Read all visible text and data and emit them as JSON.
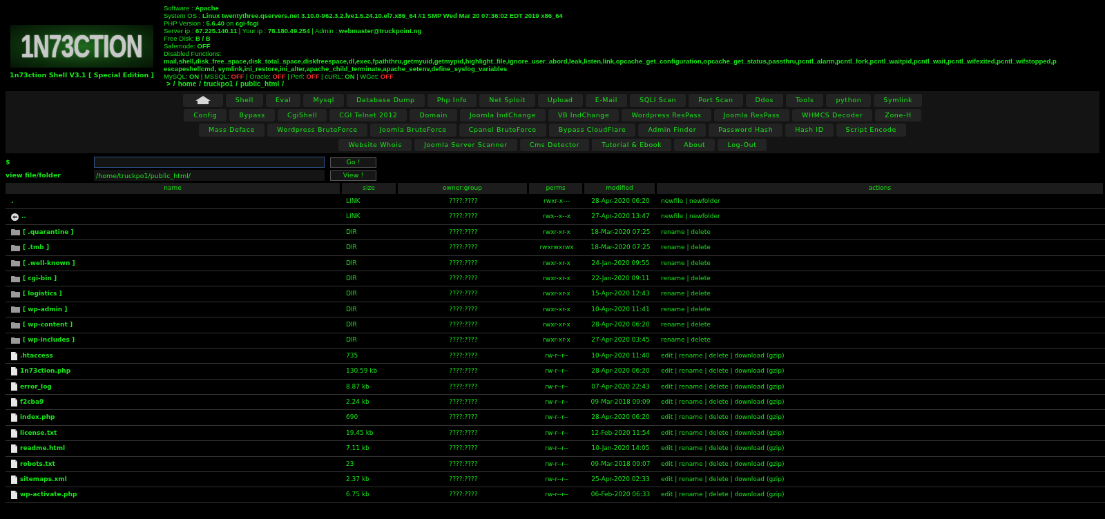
{
  "logo": {
    "text": "1N73CTION",
    "caption": "1n73ction Shell V3.1 [ Special Edition ]"
  },
  "info_lines": [
    "Software : **Apache**",
    "System OS : **Linux twentythree.qservers.net 3.10.0-962.3.2.lve1.5.24.10.el7.x86_64 #1 SMP Wed Mar 20 07:36:02 EDT 2019 x86_64**",
    "PHP Version : **5.6.40** on **cgi-fcgi**",
    "Server ip : **67.225.140.11** | Your ip : **78.180.49.254** | Admin : **webmaster@truckpoint.ng**",
    "Free Disk: **B / B**",
    "Safemode: **OFF**",
    "Disabled Functions:",
    "**mail,shell,disk_free_space,disk_total_space,diskfreespace,dl,exec,fpaththru,getmyuid,getmypid,highlight_file,ignore_user_abord,leak,listen,link,opcache_get_configuration,opcache_get_status,passthru,pcntl_alarm,pcntl_fork,pcntl_waitpid,pcntl_wait,pcntl_wifexited,pcntl_wifstopped,p**",
    "**escapeshellcmd, symlink,ini_restore,ini_alter,apache_child_terminate,apache_setenv,define_syslog_variables**"
  ],
  "separator": "|",
  "services": [
    {
      "label": "MySQL:",
      "value": "ON",
      "on": true
    },
    {
      "label": "MSSQL:",
      "value": "OFF",
      "on": false
    },
    {
      "label": "Oracle:",
      "value": "OFF",
      "on": false
    },
    {
      "label": "Perl:",
      "value": "OFF",
      "on": false
    },
    {
      "label": "cURL:",
      "value": "ON",
      "on": true
    },
    {
      "label": "WGet:",
      "value": "OFF",
      "on": false
    }
  ],
  "path": {
    "prefix": ">",
    "root": "/",
    "segments": [
      "home",
      "truckpo1",
      "public_html"
    ]
  },
  "menu_rows": [
    {
      "home": true,
      "items": [
        "Shell",
        "Eval",
        "Mysql",
        "Database Dump",
        "Php Info",
        "Net Sploit",
        "Upload",
        "E-Mail",
        "SQLI Scan",
        "Port Scan",
        "Ddos",
        "Tools",
        "python",
        "Symlink"
      ]
    },
    {
      "home": false,
      "items": [
        "Config",
        "Bypass",
        "CgiShell",
        "CGI Telnet 2012",
        "Domain",
        "Joomla IndChange",
        "VB IndChange",
        "Wordpress ResPass",
        "Joomla ResPass",
        "WHMCS Decoder",
        "Zone-H"
      ]
    },
    {
      "home": false,
      "items": [
        "Mass Deface",
        "Wordpress BruteForce",
        "Joomla BruteForce",
        "Cpanel BruteForce",
        "Bypass CloudFlare",
        "Admin Finder",
        "Password Hash",
        "Hash ID",
        "Script Encode"
      ]
    },
    {
      "home": false,
      "items": [
        "Website Whois",
        "Joomla Server Scanner",
        "Cms Detector",
        "Tutorial & Ebook",
        "About",
        "Log-Out"
      ]
    }
  ],
  "command": {
    "label": "$",
    "button": "Go !"
  },
  "view": {
    "label": "view file/folder",
    "value": "/home/truckpo1/public_html/",
    "button": "View !"
  },
  "table": {
    "columns": [
      "name",
      "size",
      "owner:group",
      "perms",
      "modified",
      "actions"
    ],
    "rows": [
      {
        "kind": "link",
        "name": ".",
        "size": "LINK",
        "owner": "????:????",
        "perms": "rwxr-x---",
        "modified": "28-Apr-2020 06:20",
        "actions": [
          "newfile",
          "newfolder"
        ]
      },
      {
        "kind": "parent",
        "name": "..",
        "size": "LINK",
        "owner": "????:????",
        "perms": "rwx--x--x",
        "modified": "27-Apr-2020 13:47",
        "actions": [
          "newfile",
          "newfolder"
        ]
      },
      {
        "kind": "dir",
        "name": "[ .quarantine ]",
        "size": "DIR",
        "owner": "????:????",
        "perms": "rwxr-xr-x",
        "modified": "18-Mar-2020 07:25",
        "actions": [
          "rename",
          "delete"
        ]
      },
      {
        "kind": "dir",
        "name": "[ .tmb ]",
        "size": "DIR",
        "owner": "????:????",
        "perms": "rwxrwxrwx",
        "modified": "18-Mar-2020 07:25",
        "actions": [
          "rename",
          "delete"
        ]
      },
      {
        "kind": "dir",
        "name": "[ .well-known ]",
        "size": "DIR",
        "owner": "????:????",
        "perms": "rwxr-xr-x",
        "modified": "24-Jan-2020 09:55",
        "actions": [
          "rename",
          "delete"
        ]
      },
      {
        "kind": "dir",
        "name": "[ cgi-bin ]",
        "size": "DIR",
        "owner": "????:????",
        "perms": "rwxr-xr-x",
        "modified": "22-Jan-2020 09:11",
        "actions": [
          "rename",
          "delete"
        ]
      },
      {
        "kind": "dir",
        "name": "[ logistics ]",
        "size": "DIR",
        "owner": "????:????",
        "perms": "rwxr-xr-x",
        "modified": "15-Apr-2020 12:43",
        "actions": [
          "rename",
          "delete"
        ]
      },
      {
        "kind": "dir",
        "name": "[ wp-admin ]",
        "size": "DIR",
        "owner": "????:????",
        "perms": "rwxr-xr-x",
        "modified": "10-Apr-2020 11:41",
        "actions": [
          "rename",
          "delete"
        ]
      },
      {
        "kind": "dir",
        "name": "[ wp-content ]",
        "size": "DIR",
        "owner": "????:????",
        "perms": "rwxr-xr-x",
        "modified": "28-Apr-2020 06:20",
        "actions": [
          "rename",
          "delete"
        ]
      },
      {
        "kind": "dir",
        "name": "[ wp-includes ]",
        "size": "DIR",
        "owner": "????:????",
        "perms": "rwxr-xr-x",
        "modified": "27-Apr-2020 03:45",
        "actions": [
          "rename",
          "delete"
        ]
      },
      {
        "kind": "file",
        "name": ".htaccess",
        "size": "735",
        "owner": "????:????",
        "perms": "rw-r--r--",
        "modified": "10-Apr-2020 11:40",
        "actions": [
          "edit",
          "rename",
          "delete",
          "download (gzip)"
        ]
      },
      {
        "kind": "file",
        "name": "1n73ction.php",
        "size": "130.59 kb",
        "owner": "????:????",
        "perms": "rw-r--r--",
        "modified": "28-Apr-2020 06:20",
        "actions": [
          "edit",
          "rename",
          "delete",
          "download (gzip)"
        ]
      },
      {
        "kind": "file",
        "name": "error_log",
        "size": "8.87 kb",
        "owner": "????:????",
        "perms": "rw-r--r--",
        "modified": "07-Apr-2020 22:43",
        "actions": [
          "edit",
          "rename",
          "delete",
          "download (gzip)"
        ]
      },
      {
        "kind": "file",
        "name": "f2cba9",
        "size": "2.24 kb",
        "owner": "????:????",
        "perms": "rw-r--r--",
        "modified": "09-Mar-2018 09:09",
        "actions": [
          "edit",
          "rename",
          "delete",
          "download (gzip)"
        ]
      },
      {
        "kind": "file",
        "name": "index.php",
        "size": "690",
        "owner": "????:????",
        "perms": "rw-r--r--",
        "modified": "28-Apr-2020 06:20",
        "actions": [
          "edit",
          "rename",
          "delete",
          "download (gzip)"
        ]
      },
      {
        "kind": "file",
        "name": "license.txt",
        "size": "19.45 kb",
        "owner": "????:????",
        "perms": "rw-r--r--",
        "modified": "12-Feb-2020 11:54",
        "actions": [
          "edit",
          "rename",
          "delete",
          "download (gzip)"
        ]
      },
      {
        "kind": "file",
        "name": "readme.html",
        "size": "7.11 kb",
        "owner": "????:????",
        "perms": "rw-r--r--",
        "modified": "10-Jan-2020 14:05",
        "actions": [
          "edit",
          "rename",
          "delete",
          "download (gzip)"
        ]
      },
      {
        "kind": "file",
        "name": "robots.txt",
        "size": "23",
        "owner": "????:????",
        "perms": "rw-r--r--",
        "modified": "09-Mar-2018 09:07",
        "actions": [
          "edit",
          "rename",
          "delete",
          "download (gzip)"
        ]
      },
      {
        "kind": "file",
        "name": "sitemaps.xml",
        "size": "2.37 kb",
        "owner": "????:????",
        "perms": "rw-r--r--",
        "modified": "25-Apr-2020 02:33",
        "actions": [
          "edit",
          "rename",
          "delete",
          "download (gzip)"
        ]
      },
      {
        "kind": "file",
        "name": "wp-activate.php",
        "size": "6.75 kb",
        "owner": "????:????",
        "perms": "rw-r--r--",
        "modified": "06-Feb-2020 06:33",
        "actions": [
          "edit",
          "rename",
          "delete",
          "download (gzip)"
        ]
      }
    ]
  }
}
